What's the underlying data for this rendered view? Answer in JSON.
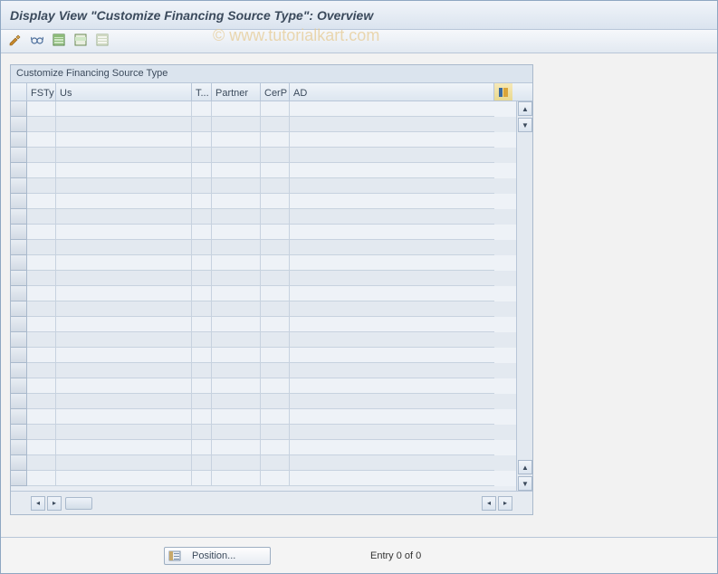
{
  "title": "Display View \"Customize Financing Source Type\": Overview",
  "watermark": "© www.tutorialkart.com",
  "panel": {
    "title": "Customize Financing Source Type",
    "columns": {
      "fsty": "FSTy",
      "us": "Us",
      "t": "T...",
      "partner": "Partner",
      "cerp": "CerP",
      "ad": "AD"
    },
    "rows": []
  },
  "toolbar_icons": {
    "change": "change-display-icon",
    "glasses": "glasses-icon",
    "select_all": "select-all-icon",
    "select_block": "select-block-icon",
    "deselect_all": "deselect-all-icon"
  },
  "footer": {
    "position_label": "Position...",
    "entry_text": "Entry 0 of 0"
  },
  "colors": {
    "accent": "#8ea7c2",
    "header_text": "#3b4a5c",
    "row_alt1": "#eef2f7",
    "row_alt2": "#e3e9f0"
  }
}
